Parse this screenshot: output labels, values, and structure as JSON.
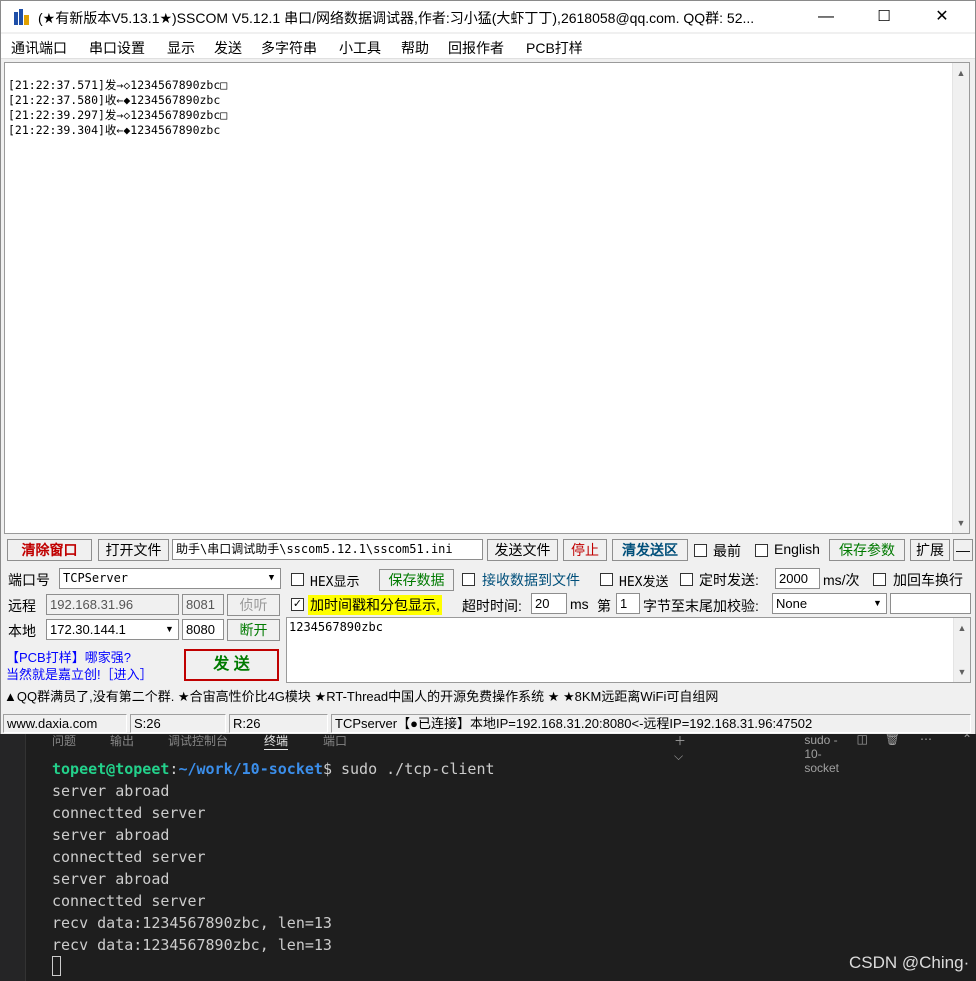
{
  "window": {
    "title": "(★有新版本V5.13.1★)SSCOM V5.12.1 串口/网络数据调试器,作者:习小猛(大虾丁丁),2618058@qq.com. QQ群: 52...",
    "minimize": "—",
    "maximize": "☐",
    "close": "✕"
  },
  "menu": [
    "通讯端口",
    "串口设置",
    "显示",
    "发送",
    "多字符串",
    "小工具",
    "帮助",
    "回报作者",
    "PCB打样"
  ],
  "receive_lines": [
    "[21:22:37.571]发→◇1234567890zbc□",
    "[21:22:37.580]收←◆1234567890zbc",
    "[21:22:39.297]发→◇1234567890zbc□",
    "[21:22:39.304]收←◆1234567890zbc"
  ],
  "toolbar": {
    "clear": "清除窗口",
    "open_file": "打开文件",
    "file_path": "助手\\串口调试助手\\sscom5.12.1\\sscom51.ini",
    "send_file": "发送文件",
    "stop": "停止",
    "clear_send": "清发送区",
    "topmost": "最前",
    "english": "English",
    "save_params": "保存参数",
    "expand": "扩展",
    "minus": "—"
  },
  "connection": {
    "port_label": "端口号",
    "port_value": "TCPServer",
    "remote_label": "远程",
    "remote_ip": "192.168.31.96",
    "remote_port": "8081",
    "listen": "侦听",
    "local_label": "本地",
    "local_ip": "172.30.144.1",
    "local_port": "8080",
    "disconnect": "断开",
    "ad_line1": "【PCB打样】哪家强?",
    "ad_line2": "当然就是嘉立创!［进入］",
    "send": "发 送"
  },
  "options": {
    "hex_display": "HEX显示",
    "save_data": "保存数据",
    "recv_to_file": "接收数据到文件",
    "hex_send": "HEX发送",
    "timed_send": "定时发送:",
    "interval": "2000",
    "interval_unit": "ms/次",
    "crlf": "加回车换行",
    "timestamp": "加时间戳和分包显示,",
    "timeout_label": "超时时间:",
    "timeout": "20",
    "timeout_unit": "ms",
    "nth_label": "第",
    "nth": "1",
    "checksum_label": "字节至末尾加校验:",
    "checksum": "None"
  },
  "send_text": "1234567890zbc",
  "ticker": "▲QQ群满员了,没有第二个群. ★合宙高性价比4G模块 ★RT-Thread中国人的开源免费操作系统 ★ ★8KM远距离WiFi可自组网",
  "status": {
    "site": "www.daxia.com",
    "sent": "S:26",
    "received": "R:26",
    "connection": "TCPserver【●已连接】本地IP=192.168.31.20:8080<-远程IP=192.168.31.96:47502"
  },
  "vscode": {
    "tabs": [
      "问题",
      "输出",
      "调试控制台",
      "终端",
      "端口"
    ],
    "active_tab": "终端",
    "terminal_name": "sudo - 10-socket",
    "prompt_user": "topeet@topeet",
    "prompt_path": "~/work/10-socket",
    "command": "$ sudo ./tcp-client",
    "output": [
      "server abroad",
      "connectted server",
      "server abroad",
      "connectted server",
      "server abroad",
      "connectted server",
      "recv data:1234567890zbc, len=13",
      "recv data:1234567890zbc, len=13"
    ]
  },
  "watermark": "CSDN @Ching·"
}
